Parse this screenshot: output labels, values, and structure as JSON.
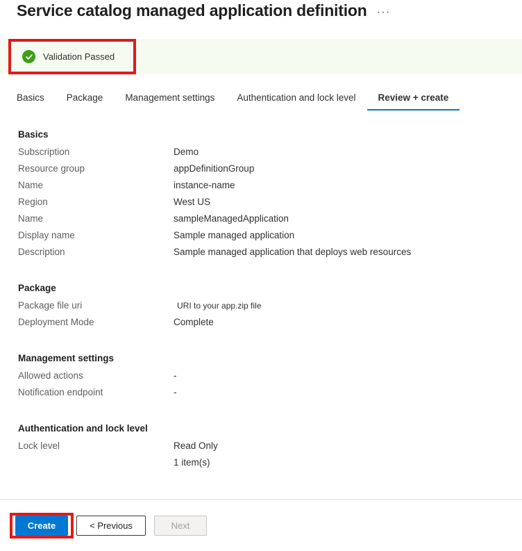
{
  "header": {
    "title": "Service catalog managed application definition",
    "more_label": "···"
  },
  "validation": {
    "text": "Validation Passed",
    "icon": "check-circle-icon",
    "background_color": "#f6fbf2",
    "icon_color": "#3aa017",
    "highlight_color": "#e01b1b"
  },
  "tabs": [
    {
      "label": "Basics",
      "active": false
    },
    {
      "label": "Package",
      "active": false
    },
    {
      "label": "Management settings",
      "active": false
    },
    {
      "label": "Authentication and lock level",
      "active": false
    },
    {
      "label": "Review + create",
      "active": true
    }
  ],
  "sections": [
    {
      "title": "Basics",
      "rows": [
        {
          "label": "Subscription",
          "value": "Demo"
        },
        {
          "label": "Resource group",
          "value": "appDefinitionGroup"
        },
        {
          "label": "Name",
          "value": "instance-name"
        },
        {
          "label": "Region",
          "value": "West US"
        },
        {
          "label": "Name",
          "value": "sampleManagedApplication"
        },
        {
          "label": "Display name",
          "value": "Sample managed application"
        },
        {
          "label": "Description",
          "value": "Sample managed application that deploys web resources"
        }
      ]
    },
    {
      "title": "Package",
      "rows": [
        {
          "label": "Package file uri",
          "value": "URI to your app.zip file"
        },
        {
          "label": "Deployment Mode",
          "value": "Complete"
        }
      ]
    },
    {
      "title": "Management settings",
      "rows": [
        {
          "label": "Allowed actions",
          "value": "-"
        },
        {
          "label": "Notification endpoint",
          "value": "-"
        }
      ]
    },
    {
      "title": "Authentication and lock level",
      "rows": [
        {
          "label": "Lock level",
          "value": "Read Only"
        },
        {
          "label": "",
          "value": "1 item(s)"
        }
      ]
    }
  ],
  "footer": {
    "create_label": "Create",
    "previous_label": "< Previous",
    "next_label": "Next",
    "accent_color": "#0078d4"
  }
}
